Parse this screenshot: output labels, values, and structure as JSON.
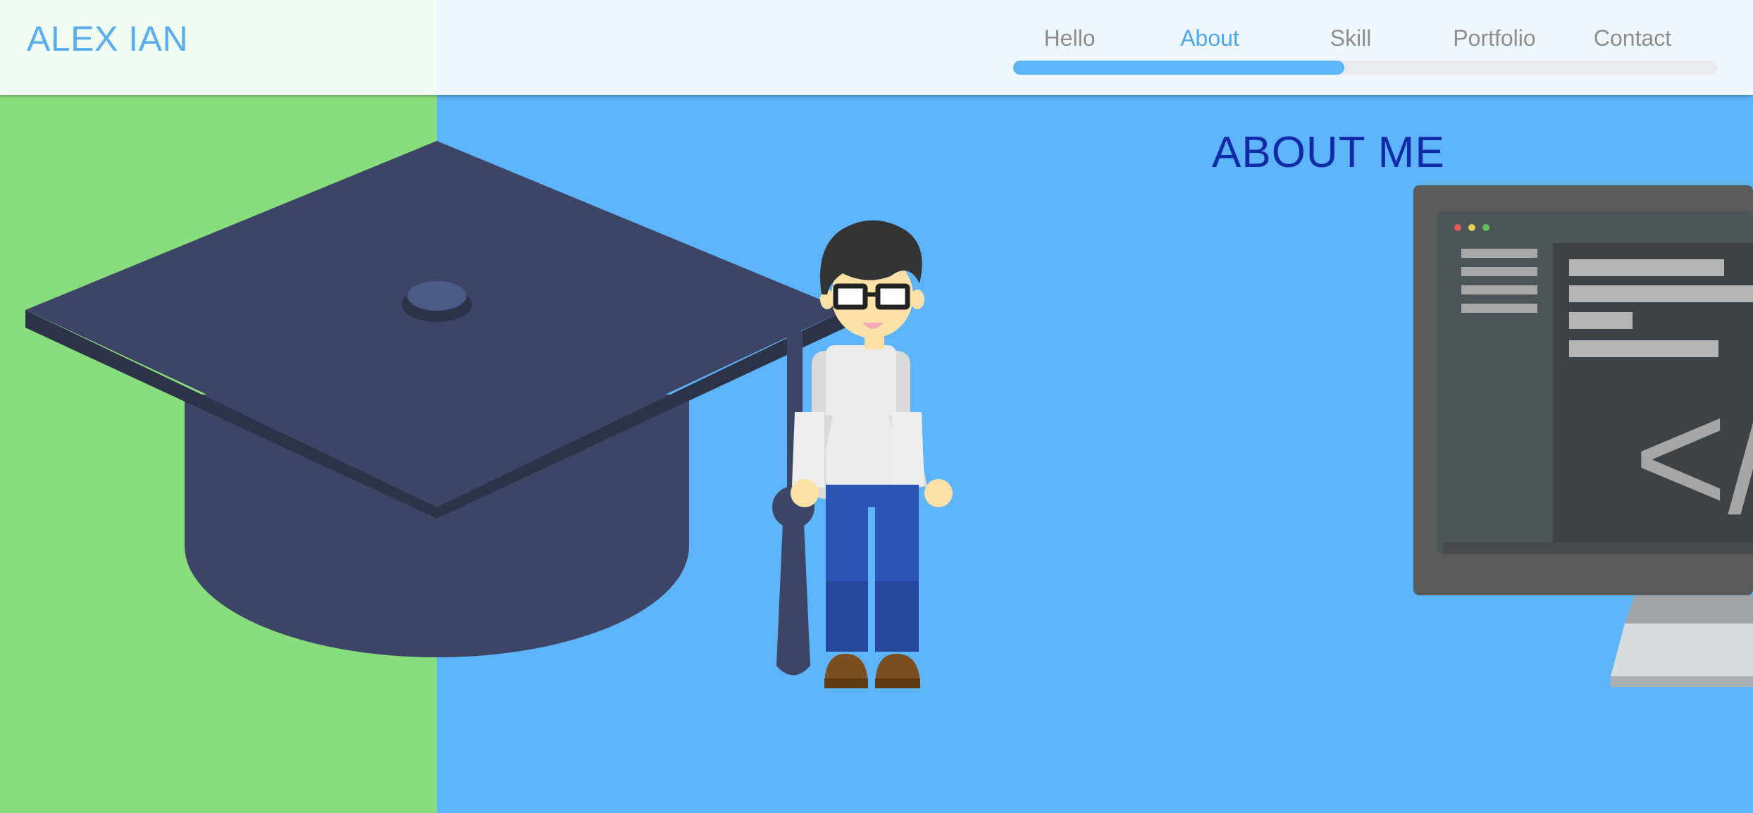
{
  "header": {
    "logo": "ALEX IAN",
    "nav": [
      {
        "label": "Hello",
        "active": false
      },
      {
        "label": "About",
        "active": true
      },
      {
        "label": "Skill",
        "active": false
      },
      {
        "label": "Portfolio",
        "active": false
      },
      {
        "label": "Contact",
        "active": false
      }
    ],
    "progress_fraction": 0.47
  },
  "section": {
    "title": "ABOUT ME"
  },
  "illustrations": {
    "graduation_cap": "graduation-cap-icon",
    "person": "person-with-glasses-illustration",
    "monitor": "computer-monitor-code-illustration",
    "monitor_code_glyph": "</"
  },
  "colors": {
    "left_bg": "#88de7c",
    "right_bg": "#5db4f8",
    "header_bg": "#eef6fe",
    "accent": "#5aaef0",
    "title": "#102aa8"
  }
}
